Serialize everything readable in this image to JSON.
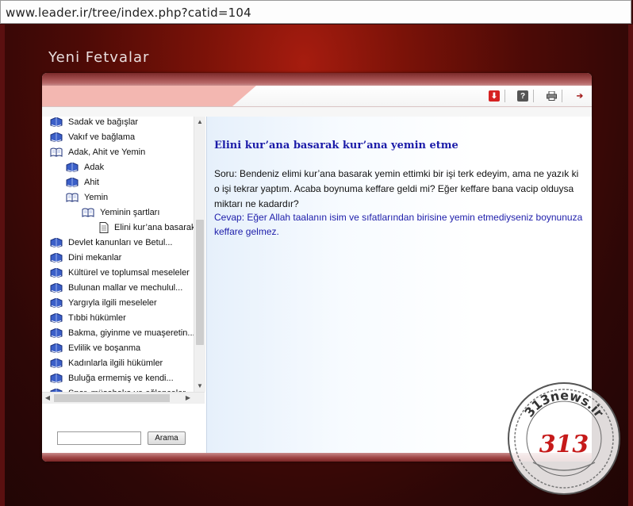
{
  "browser": {
    "url": "www.leader.ir/tree/index.php?catid=104"
  },
  "page": {
    "title": "Yeni Fetvalar"
  },
  "toolbar": {
    "icons": [
      "save-icon",
      "help-icon",
      "print-icon",
      "next-icon"
    ]
  },
  "tree": {
    "items": [
      {
        "label": "Sadak ve bağışlar",
        "level": 0,
        "type": "book"
      },
      {
        "label": "Vakıf ve bağlama",
        "level": 0,
        "type": "book"
      },
      {
        "label": "Adak, Ahit ve Yemin",
        "level": 0,
        "type": "open-book"
      },
      {
        "label": "Adak",
        "level": 1,
        "type": "book"
      },
      {
        "label": "Ahit",
        "level": 1,
        "type": "book"
      },
      {
        "label": "Yemin",
        "level": 1,
        "type": "open-book"
      },
      {
        "label": "Yeminin şartları",
        "level": 2,
        "type": "open-book"
      },
      {
        "label": "Elini kur’ana basarak",
        "level": 3,
        "type": "page"
      },
      {
        "label": "Devlet kanunları ve Betul...",
        "level": 0,
        "type": "book"
      },
      {
        "label": "Dini mekanlar",
        "level": 0,
        "type": "book"
      },
      {
        "label": "Kültürel ve toplumsal meseleler",
        "level": 0,
        "type": "book"
      },
      {
        "label": "Bulunan mallar ve mechulul...",
        "level": 0,
        "type": "book"
      },
      {
        "label": "Yargıyla ilgili meseleler",
        "level": 0,
        "type": "book"
      },
      {
        "label": "Tıbbi hükümler",
        "level": 0,
        "type": "book"
      },
      {
        "label": "Bakma, giyinme ve muaşeretin...",
        "level": 0,
        "type": "book"
      },
      {
        "label": "Evlilik ve boşanma",
        "level": 0,
        "type": "book"
      },
      {
        "label": "Kadınlarla ilgili hükümler",
        "level": 0,
        "type": "book"
      },
      {
        "label": "Buluğa ermemiş ve kendi...",
        "level": 0,
        "type": "book"
      },
      {
        "label": "Spor, müsabaka ve eğlenceler",
        "level": 0,
        "type": "book"
      }
    ]
  },
  "search": {
    "value": "",
    "button_label": "Arama"
  },
  "article": {
    "title": "Elini kur’ana basarak kur’ana yemin etme",
    "question": "Soru: Bendeniz elimi kur’ana basarak yemin ettimki bir işi terk edeyim, ama ne yazık ki o işi tekrar yaptım. Acaba boynuma keffare geldi mi? Eğer keffare bana vacip olduysa miktarı ne kadardır?",
    "answer": "Cevap: Eğer Allah taalanın isim ve sıfatlarından birisine yemin etmediyseniz boynunuza keffare gelmez."
  },
  "watermark": {
    "text": "313news.ir",
    "number": "313"
  },
  "colors": {
    "link_blue": "#1d1daa",
    "accent_red": "#a61c0f",
    "tab_pink": "#f3b7b1"
  }
}
